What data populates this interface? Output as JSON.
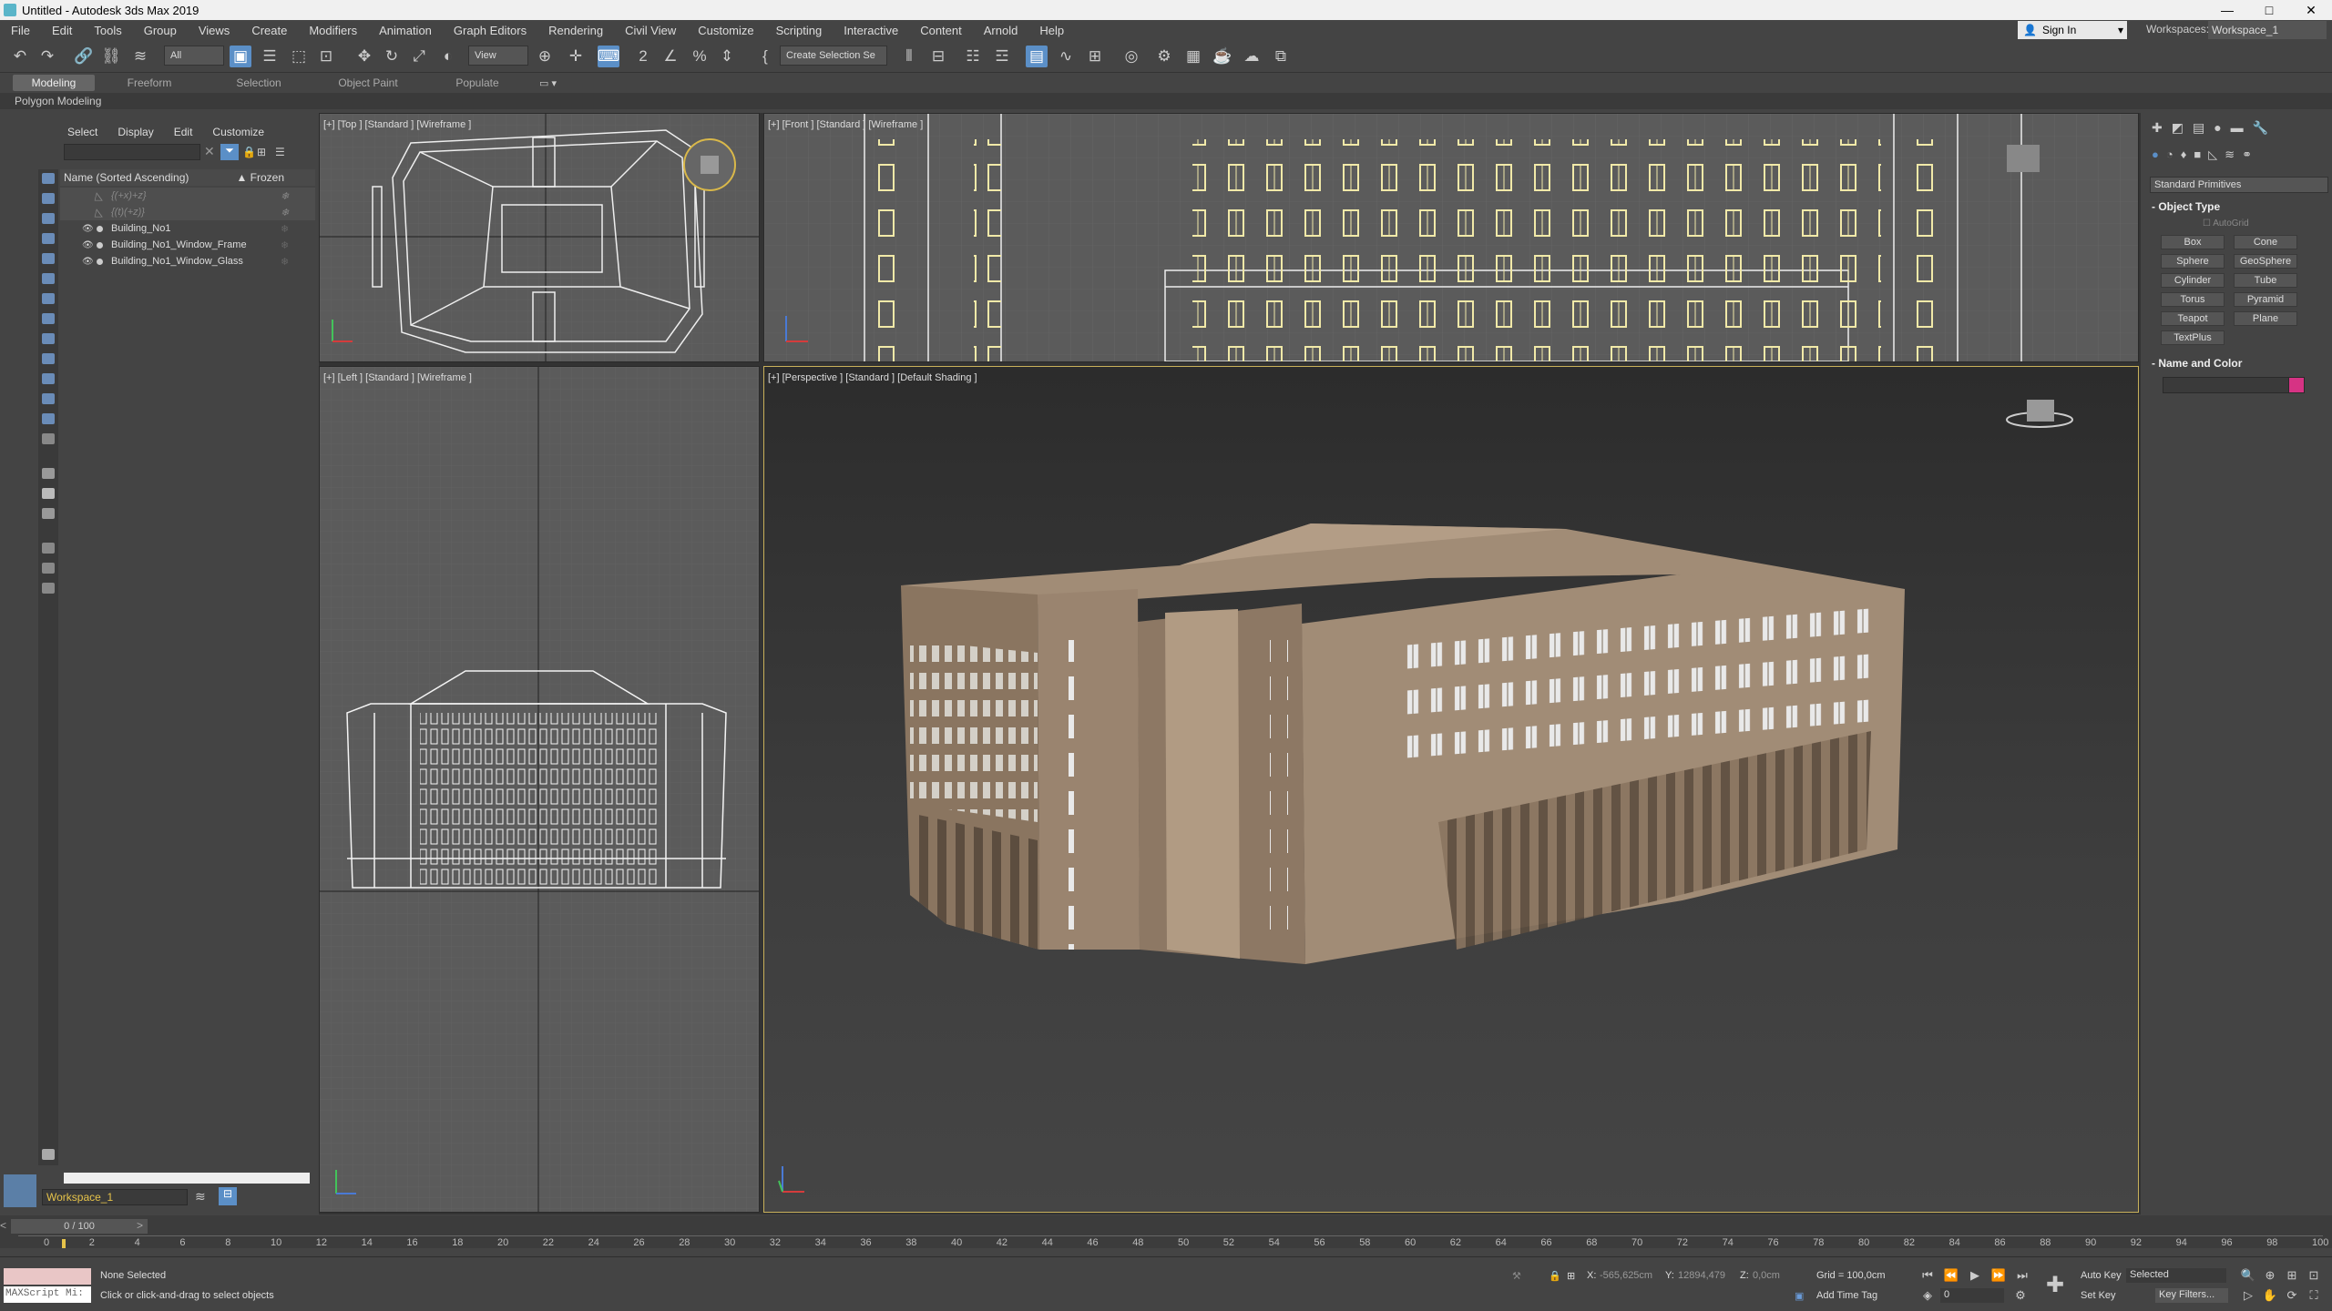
{
  "window": {
    "title": "Untitled - Autodesk 3ds Max 2019",
    "buttons": [
      "—",
      "□",
      "✕"
    ]
  },
  "menu": [
    "File",
    "Edit",
    "Tools",
    "Group",
    "Views",
    "Create",
    "Modifiers",
    "Animation",
    "Graph Editors",
    "Rendering",
    "Civil View",
    "Customize",
    "Scripting",
    "Interactive",
    "Content",
    "Arnold",
    "Help"
  ],
  "signin": {
    "label": "Sign In"
  },
  "workspaces": {
    "label": "Workspaces:",
    "value": "Workspace_1"
  },
  "toolbar": {
    "filter": "All",
    "refcoord": "View",
    "selection_set": "Create Selection Se"
  },
  "ribbon": {
    "tabs": [
      "Modeling",
      "Freeform",
      "Selection",
      "Object Paint",
      "Populate"
    ],
    "sub": "Polygon Modeling"
  },
  "explorer": {
    "tabs": [
      "Select",
      "Display",
      "Edit",
      "Customize"
    ],
    "header": {
      "name": "Name (Sorted Ascending)",
      "frozen": "▲ Frozen"
    },
    "rows": [
      {
        "label": "{(+x)+z}",
        "dim": true
      },
      {
        "label": "{(t)(+z)}",
        "dim": true
      },
      {
        "label": "Building_No1",
        "dim": false
      },
      {
        "label": "Building_No1_Window_Frame",
        "dim": false
      },
      {
        "label": "Building_No1_Window_Glass",
        "dim": false
      }
    ],
    "workspace": "Workspace_1"
  },
  "viewports": {
    "top": "[+] [Top ] [Standard ] [Wireframe ]",
    "front": "[+] [Front ] [Standard ] [Wireframe ]",
    "left": "[+] [Left ] [Standard ] [Wireframe ]",
    "persp": "[+] [Perspective ] [Standard ] [Default Shading ]"
  },
  "command_panel": {
    "dropdown": "Standard Primitives",
    "object_type": "Object Type",
    "autogrid": "AutoGrid",
    "primitives": [
      "Box",
      "Cone",
      "Sphere",
      "GeoSphere",
      "Cylinder",
      "Tube",
      "Torus",
      "Pyramid",
      "Teapot",
      "Plane",
      "TextPlus"
    ],
    "name_color": "Name and Color",
    "color": "#d63384"
  },
  "timeline": {
    "frame": "0 / 100",
    "ticks": [
      "0",
      "2",
      "4",
      "6",
      "8",
      "10",
      "12",
      "14",
      "16",
      "18",
      "20",
      "22",
      "24",
      "26",
      "28",
      "30",
      "32",
      "34",
      "36",
      "38",
      "40",
      "42",
      "44",
      "46",
      "48",
      "50",
      "52",
      "54",
      "56",
      "58",
      "60",
      "62",
      "64",
      "66",
      "68",
      "70",
      "72",
      "74",
      "76",
      "78",
      "80",
      "82",
      "84",
      "86",
      "88",
      "90",
      "92",
      "94",
      "96",
      "98",
      "100"
    ]
  },
  "status": {
    "maxscript": "MAXScript Mi:",
    "selected": "None Selected",
    "prompt": "Click or click-and-drag to select objects",
    "x_label": "X:",
    "x_value": "-565,625cm",
    "y_label": "Y:",
    "y_value": "12894,479",
    "z_label": "Z:",
    "z_value": "0,0cm",
    "grid": "Grid = 100,0cm",
    "addtimetag": "Add Time Tag",
    "autokey": "Auto Key",
    "setkey": "Set Key",
    "selected_drop": "Selected",
    "keyfilters": "Key Filters...",
    "frame_input": "0"
  }
}
